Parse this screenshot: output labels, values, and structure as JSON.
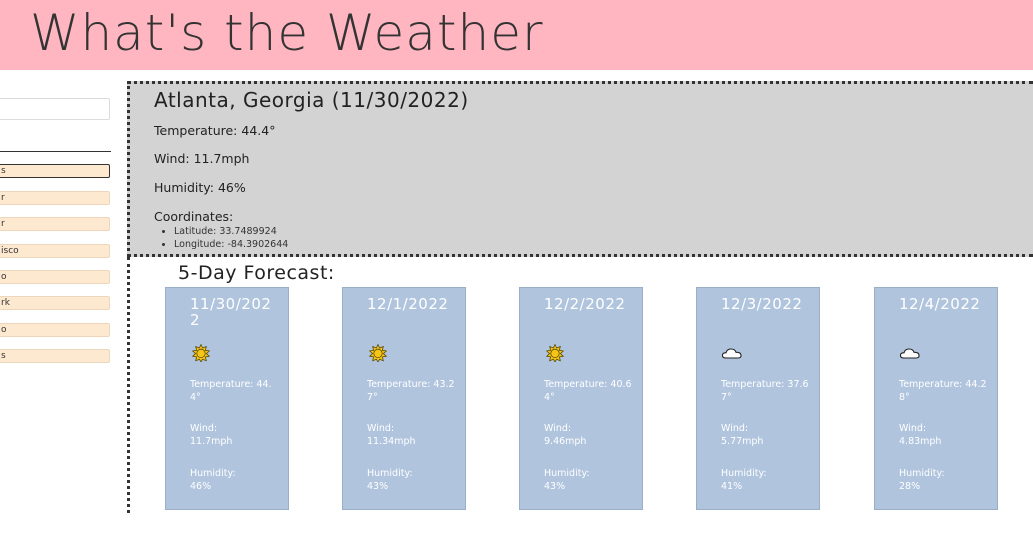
{
  "header": {
    "title": "What's the Weather"
  },
  "sidebar": {
    "search_value": "",
    "history": [
      "s",
      "r",
      "r",
      "isco",
      "o",
      "rk",
      "o",
      "s"
    ]
  },
  "current": {
    "title": "Atlanta, Georgia (11/30/2022)",
    "temperature": "Temperature: 44.4°",
    "wind": "Wind: 11.7mph",
    "humidity": "Humidity: 46%",
    "coordinates_label": "Coordinates:",
    "latitude": "Latitude: 33.7489924",
    "longitude": "Longitude: -84.3902644"
  },
  "forecast": {
    "title": "5-Day Forecast:",
    "days": [
      {
        "date": "11/30/2022",
        "icon": "sun-icon",
        "temp": "Temperature: 44.4°",
        "wind_label": "Wind:",
        "wind": "11.7mph",
        "humidity_label": "Humidity:",
        "humidity": "46%"
      },
      {
        "date": "12/1/2022",
        "icon": "sun-icon",
        "temp": "Temperature: 43.27°",
        "wind_label": "Wind:",
        "wind": "11.34mph",
        "humidity_label": "Humidity:",
        "humidity": "43%"
      },
      {
        "date": "12/2/2022",
        "icon": "sun-icon",
        "temp": "Temperature: 40.64°",
        "wind_label": "Wind:",
        "wind": "9.46mph",
        "humidity_label": "Humidity:",
        "humidity": "43%"
      },
      {
        "date": "12/3/2022",
        "icon": "cloud-icon",
        "temp": "Temperature: 37.67°",
        "wind_label": "Wind:",
        "wind": "5.77mph",
        "humidity_label": "Humidity:",
        "humidity": "41%"
      },
      {
        "date": "12/4/2022",
        "icon": "cloud-icon",
        "temp": "Temperature: 44.28°",
        "wind_label": "Wind:",
        "wind": "4.83mph",
        "humidity_label": "Humidity:",
        "humidity": "28%"
      }
    ]
  },
  "colors": {
    "header_bg": "#ffb6c1",
    "card_bg": "#b0c4de",
    "current_bg": "#d3d3d3",
    "history_btn_bg": "#fde8d0",
    "sun": "#f5c518"
  }
}
